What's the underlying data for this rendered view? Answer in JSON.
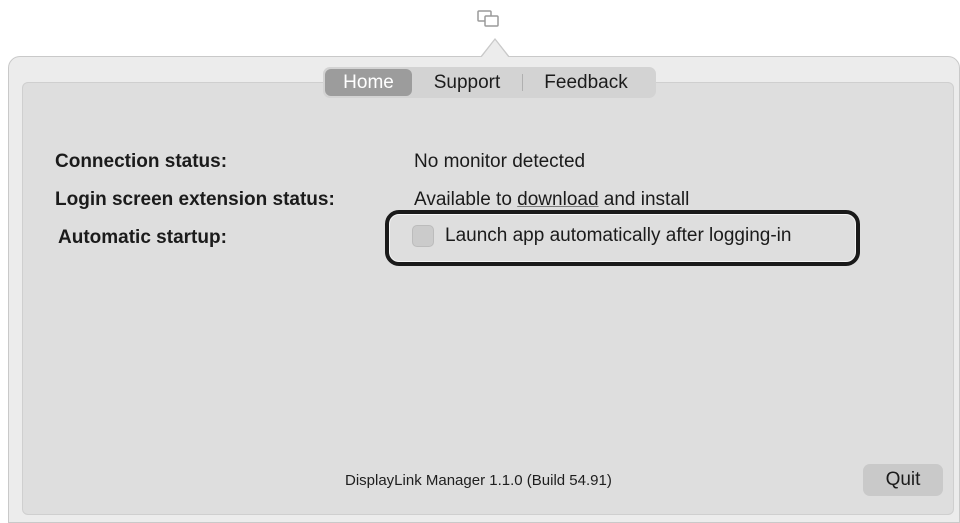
{
  "menubar": {
    "icon": "displaylink-screens-icon"
  },
  "tabs": [
    {
      "label": "Home",
      "selected": true
    },
    {
      "label": "Support",
      "selected": false
    },
    {
      "label": "Feedback",
      "selected": false
    }
  ],
  "status": {
    "connection_label": "Connection status:",
    "connection_value": "No monitor detected",
    "login_ext_label": "Login screen extension status:",
    "login_ext_prefix": "Available to ",
    "login_ext_link": "download",
    "login_ext_suffix": " and install",
    "startup_label": "Automatic startup:",
    "startup_checkbox_label": "Launch app automatically after logging-in",
    "startup_checked": false
  },
  "footer": {
    "version": "DisplayLink Manager 1.1.0 (Build 54.91)",
    "quit_label": "Quit"
  },
  "colors": {
    "popover_bg": "#ececec",
    "panel_bg": "#dedede",
    "selected_tab": "#9c9c9c",
    "highlight_border": "#1a1a1a"
  }
}
